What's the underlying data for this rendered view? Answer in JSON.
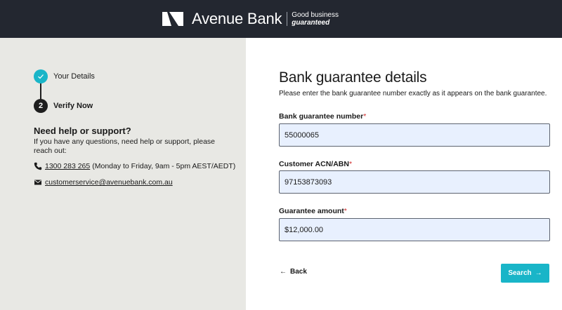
{
  "header": {
    "brand_name": "Avenue Bank",
    "tagline_line1": "Good business",
    "tagline_line2": "guaranteed"
  },
  "steps": [
    {
      "label": "Your Details",
      "state": "completed",
      "icon": "check-icon"
    },
    {
      "label": "Verify Now",
      "state": "current",
      "number": "2"
    }
  ],
  "help": {
    "title": "Need help or support?",
    "text": "If you have any questions, need help or support, please reach out:",
    "phone": "1300 283 265",
    "phone_hours": "(Monday to Friday, 9am - 5pm AEST/AEDT)",
    "email": "customerservice@avenuebank.com.au"
  },
  "form": {
    "title": "Bank guarantee details",
    "subtitle": "Please enter the bank guarantee number exactly as it appears on the bank guarantee.",
    "required_mark": "*",
    "fields": [
      {
        "label": "Bank guarantee number",
        "value": "55000065"
      },
      {
        "label": "Customer ACN/ABN",
        "value": "97153873093"
      },
      {
        "label": "Guarantee amount",
        "value": "$12,000.00"
      }
    ],
    "back_label": "Back",
    "search_label": "Search"
  },
  "colors": {
    "header_bg": "#232730",
    "accent": "#19b5c8",
    "left_panel_bg": "#e8e8e4",
    "input_bg": "#e8f0fe",
    "required": "#d02a2a"
  }
}
